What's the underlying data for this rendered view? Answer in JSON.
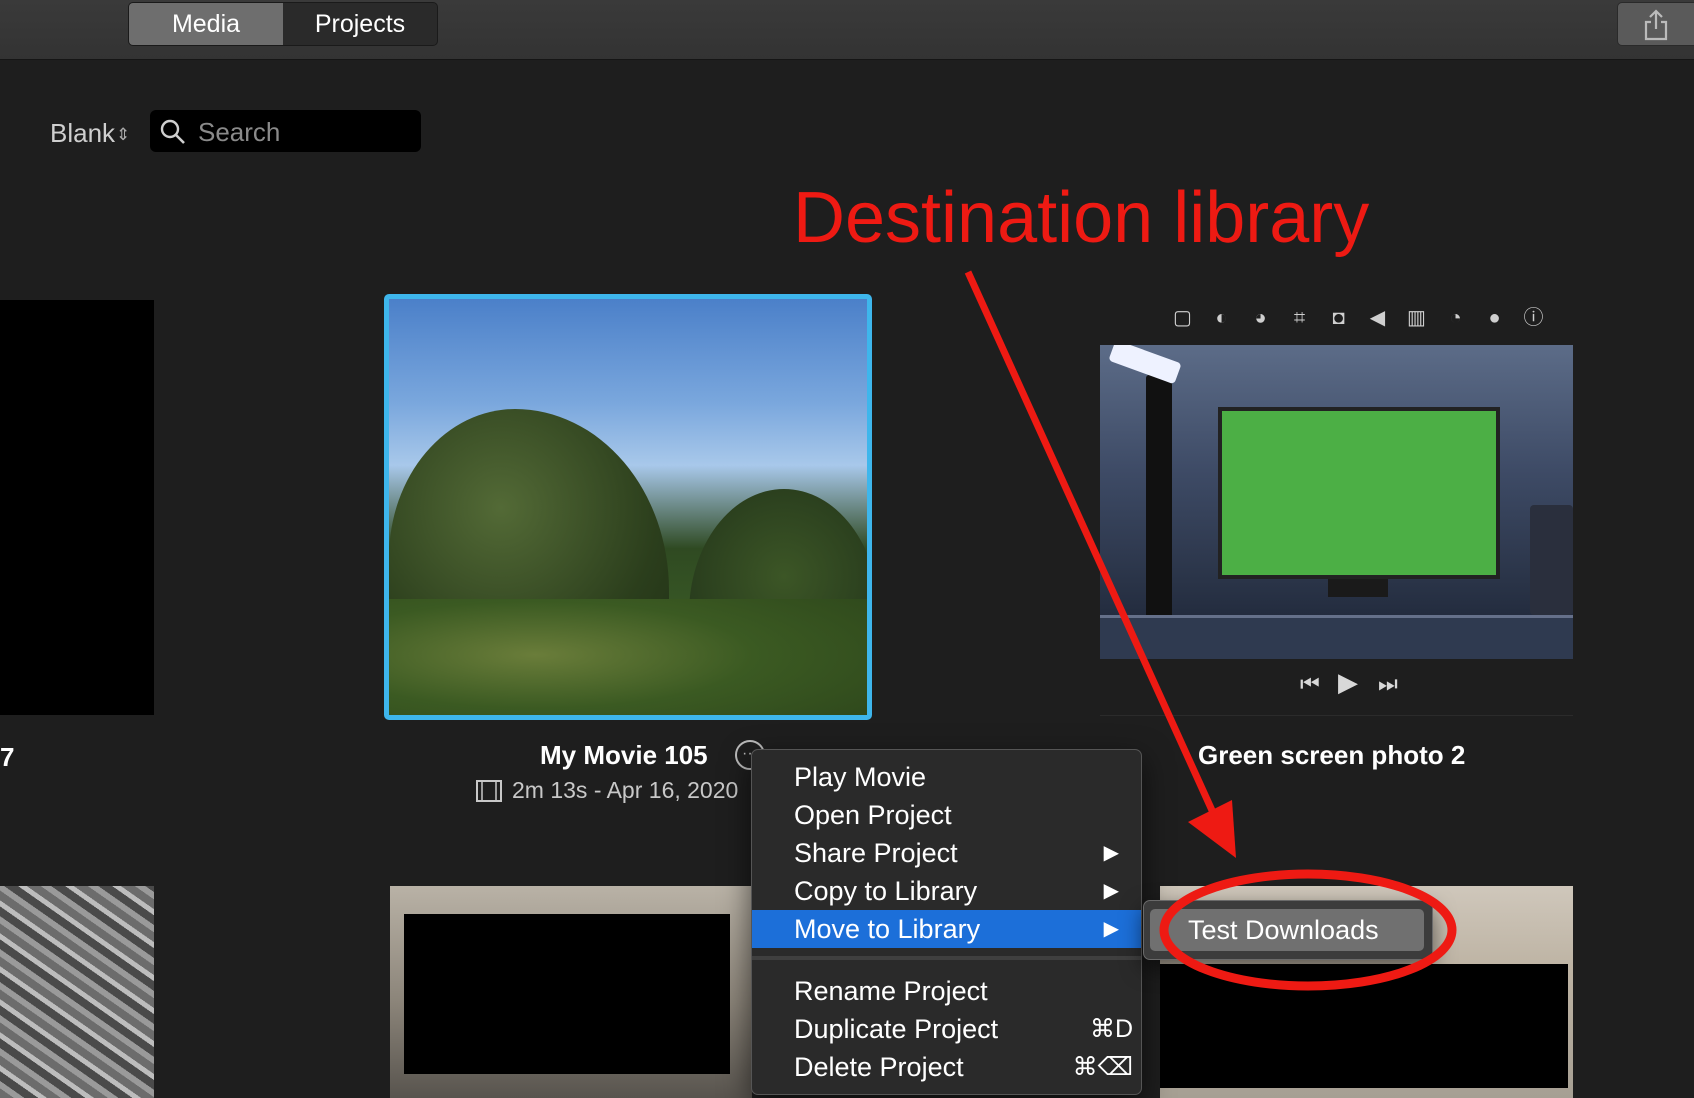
{
  "toolbar": {
    "tabs": [
      {
        "label": "Media",
        "selected": true
      },
      {
        "label": "Projects",
        "selected": false
      }
    ],
    "share_icon": "share-icon"
  },
  "filter": {
    "view_label": "Blank",
    "search_placeholder": "Search"
  },
  "annotation": {
    "text": "Destination library",
    "color": "#ee1a13"
  },
  "left_column": {
    "partial_text": "7"
  },
  "project": {
    "title": "My Movie 105",
    "meta": "2m 13s - Apr 16, 2020"
  },
  "viewer": {
    "tools": [
      "crop-icon",
      "color-balance-icon",
      "color-palette-icon",
      "crop-tool-icon",
      "stabilize-icon",
      "volume-icon",
      "noise-reduction-icon",
      "speed-icon",
      "filter-icon",
      "info-icon"
    ],
    "clip_title": "Green screen photo 2",
    "controls": [
      "previous-icon",
      "play-icon",
      "next-icon"
    ]
  },
  "context_menu": {
    "items": [
      {
        "label": "Play Movie",
        "submenu": false,
        "shortcut": ""
      },
      {
        "label": "Open Project",
        "submenu": false,
        "shortcut": ""
      },
      {
        "label": "Share Project",
        "submenu": true,
        "shortcut": ""
      },
      {
        "label": "Copy to Library",
        "submenu": true,
        "shortcut": ""
      },
      {
        "label": "Move to Library",
        "submenu": true,
        "shortcut": "",
        "highlighted": true
      },
      {
        "label": "Rename Project",
        "submenu": false,
        "shortcut": ""
      },
      {
        "label": "Duplicate Project",
        "submenu": false,
        "shortcut": "⌘D"
      },
      {
        "label": "Delete Project",
        "submenu": false,
        "shortcut": "⌘⌫"
      }
    ]
  },
  "submenu": {
    "items": [
      {
        "label": "Test Downloads"
      }
    ]
  },
  "colors": {
    "selection_border": "#3eb6ec",
    "menu_highlight": "#1c6fd9",
    "green_screen": "#4caf45"
  }
}
